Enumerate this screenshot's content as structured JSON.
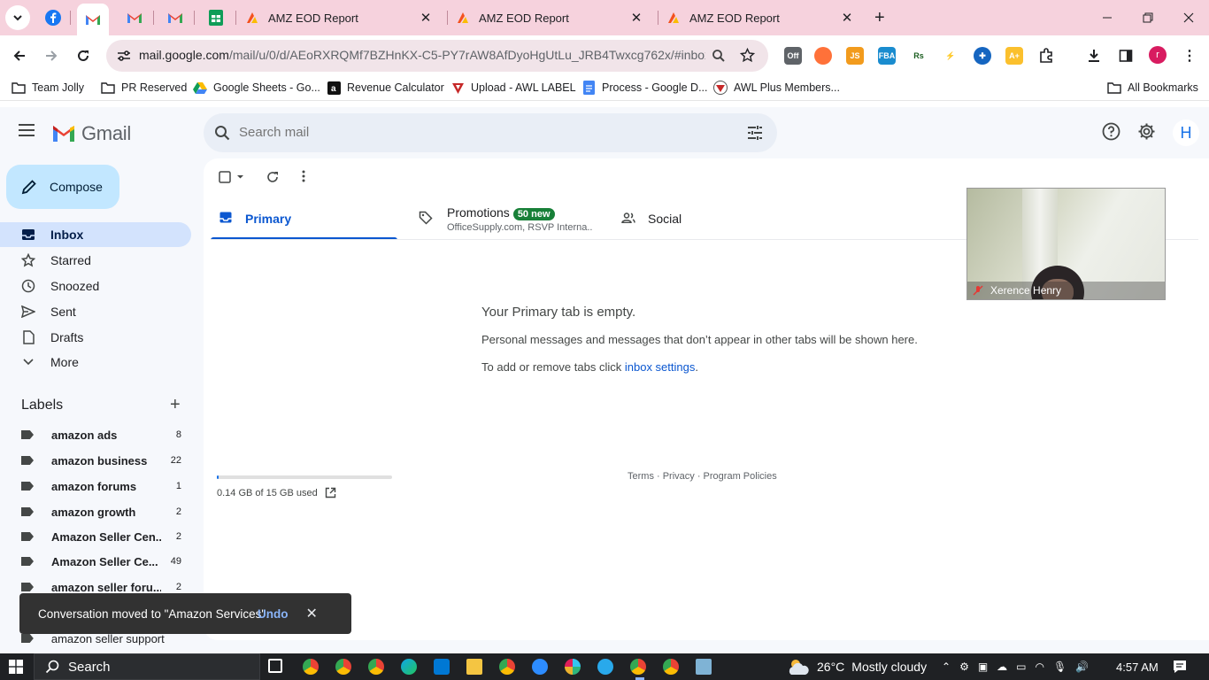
{
  "browser": {
    "tabs": [
      {
        "title": "AMZ EOD Report"
      },
      {
        "title": "AMZ EOD Report"
      },
      {
        "title": "AMZ EOD Report"
      }
    ],
    "url_host": "mail.google.com",
    "url_path": "/mail/u/0/d/AEoRXRQMf7BZHnKX-C5-PY7rAW8AfDyoHgUtLu_JRB4Twxcg762x/#inbox",
    "profile_initial": "r",
    "ext_off_label": "Off",
    "bookmarks": [
      {
        "label": "Team Jolly",
        "icon": "folder-icon"
      },
      {
        "label": "PR Reserved",
        "icon": "folder-icon"
      },
      {
        "label": "Google Sheets - Go...",
        "icon": "google-drive-icon"
      },
      {
        "label": "Revenue Calculator",
        "icon": "amazon-icon"
      },
      {
        "label": "Upload - AWL LABEL",
        "icon": "awl-icon"
      },
      {
        "label": "Process - Google D...",
        "icon": "google-docs-icon"
      },
      {
        "label": "AWL Plus Members...",
        "icon": "awl-plus-icon"
      }
    ],
    "all_bookmarks": "All Bookmarks"
  },
  "gmail": {
    "brand": "Gmail",
    "search_placeholder": "Search mail",
    "account_initial": "H",
    "compose": "Compose",
    "nav": [
      {
        "label": "Inbox",
        "icon": "inbox-icon",
        "selected": true
      },
      {
        "label": "Starred",
        "icon": "star-icon"
      },
      {
        "label": "Snoozed",
        "icon": "clock-icon"
      },
      {
        "label": "Sent",
        "icon": "send-icon"
      },
      {
        "label": "Drafts",
        "icon": "draft-icon"
      },
      {
        "label": "More",
        "icon": "chevron-down-icon"
      }
    ],
    "labels_header": "Labels",
    "labels": [
      {
        "name": "amazon ads",
        "count": "8"
      },
      {
        "name": "amazon business",
        "count": "22"
      },
      {
        "name": "amazon forums",
        "count": "1"
      },
      {
        "name": "amazon growth",
        "count": "2"
      },
      {
        "name": "Amazon Seller Cen...",
        "count": "2"
      },
      {
        "name": "Amazon Seller Ce...",
        "count": "49"
      },
      {
        "name": "amazon seller foru...",
        "count": "2"
      },
      {
        "name": "amazon seller support",
        "count": ""
      }
    ],
    "inbox_tabs": [
      {
        "label": "Primary",
        "icon": "inbox-tab-icon",
        "selected": true
      },
      {
        "label": "Promotions",
        "icon": "tag-icon",
        "badge": "50 new",
        "subtitle": "OfficeSupply.com, RSVP Interna..."
      },
      {
        "label": "Social",
        "icon": "people-icon"
      }
    ],
    "empty_title": "Your Primary tab is empty.",
    "empty_line1": "Personal messages and messages that don’t appear in other tabs will be shown here.",
    "empty_line2_prefix": "To add or remove tabs click ",
    "empty_line2_link": "inbox settings",
    "empty_line2_suffix": ".",
    "storage_used_fraction": 0.0093,
    "storage_text": "0.14 GB of 15 GB used",
    "footer": "Terms · Privacy · Program Policies",
    "video_name": "Xerence Henry",
    "snackbar_message": "Conversation moved to \"Amazon Services\".",
    "snackbar_action": "Undo"
  },
  "taskbar": {
    "search_label": "Search",
    "temperature": "26°C",
    "weather": "Mostly cloudy",
    "time": "4:57 AM"
  }
}
